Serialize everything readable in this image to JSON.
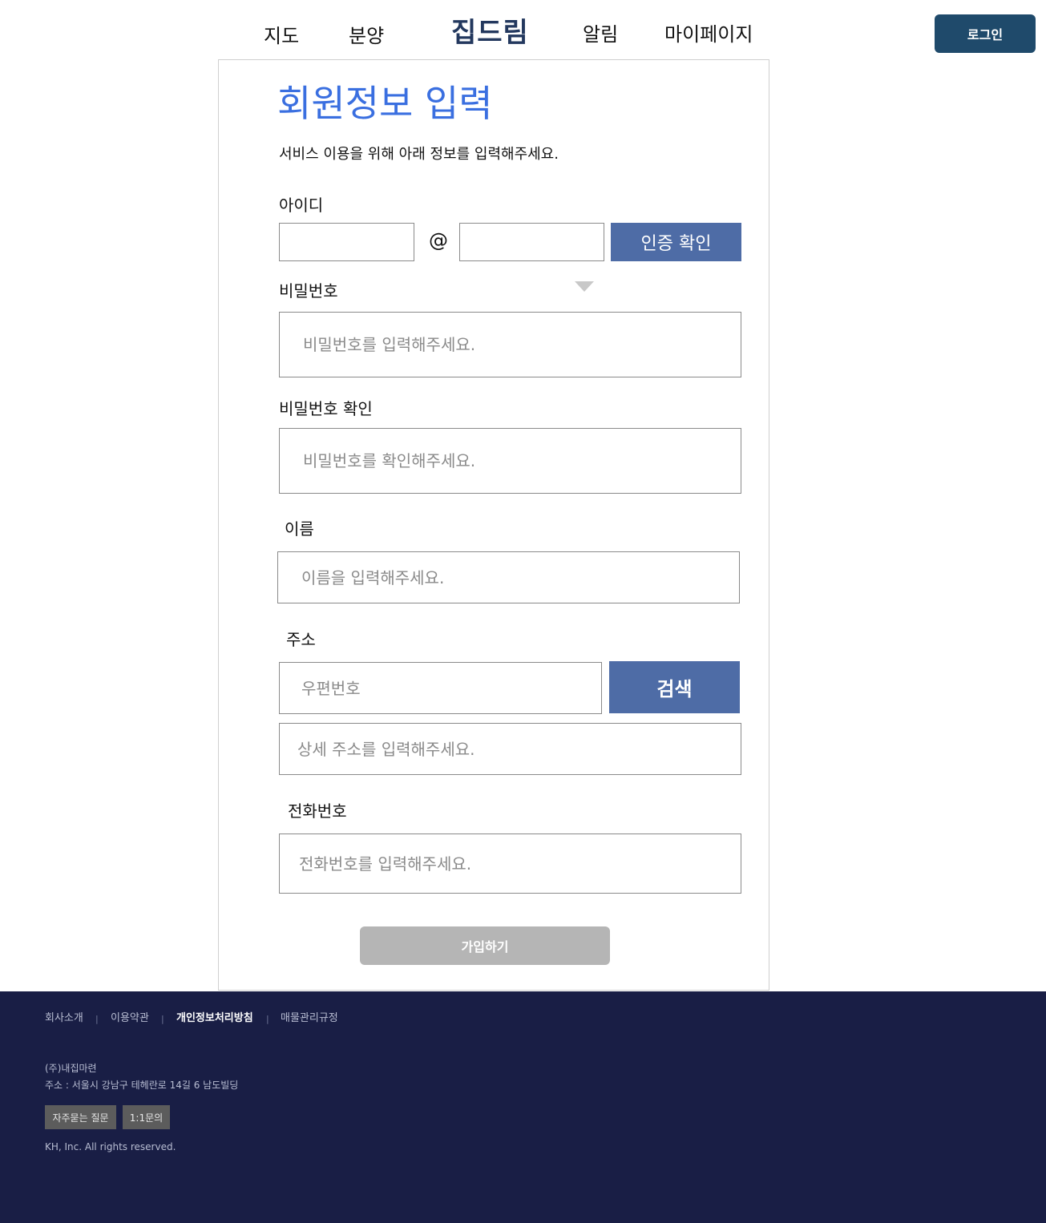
{
  "header": {
    "nav": [
      "지도",
      "분양",
      "알림",
      "마이페이지"
    ],
    "brand": "집드림",
    "login_label": "로그인"
  },
  "form": {
    "title": "회원정보 입력",
    "subtitle": "서비스 이용을 위해 아래 정보를 입력해주세요.",
    "id_label": "아이디",
    "at_symbol": "@",
    "verify_button": "인증 확인",
    "password_label": "비밀번호",
    "password_placeholder": "비밀번호를 입력해주세요.",
    "password_confirm_label": "비밀번호 확인",
    "password_confirm_placeholder": "비밀번호를 확인해주세요.",
    "name_label": "이름",
    "name_placeholder": "이름을 입력해주세요.",
    "address_label": "주소",
    "zipcode_placeholder": "우편번호",
    "search_button": "검색",
    "address_detail_placeholder": "상세 주소를 입력해주세요.",
    "phone_label": "전화번호",
    "phone_placeholder": "전화번호를 입력해주세요.",
    "submit_button": "가입하기"
  },
  "footer": {
    "links": [
      "회사소개",
      "이용약관",
      "개인정보처리방침",
      "매물관리규정"
    ],
    "separator": "|",
    "company": "(주)내집마련",
    "address": "주소 : 서울시 강남구 테헤란로 14길 6 남도빌딩",
    "buttons": [
      "자주묻는 질문",
      "1:1문의"
    ],
    "copyright": "KH, Inc. All rights reserved."
  },
  "colors": {
    "title_blue": "#3a6fe0",
    "button_blue": "#4e6ca6",
    "login_button": "#1f4a6b",
    "footer_bg": "#191e45",
    "submit_disabled": "#b5b5b5"
  },
  "icons": [
    "dropdown-triangle-icon"
  ]
}
